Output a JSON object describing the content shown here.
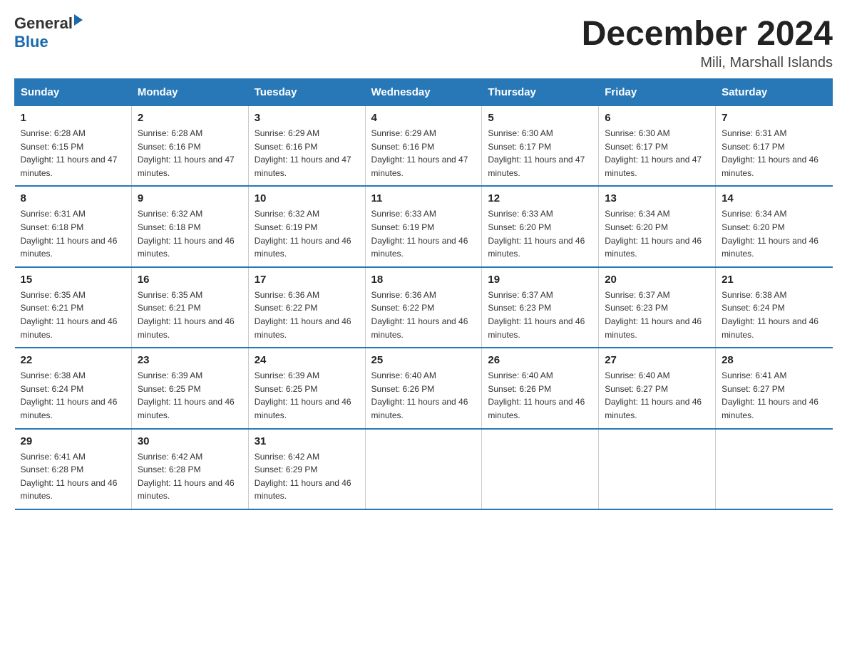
{
  "logo": {
    "general": "General",
    "blue": "Blue"
  },
  "title": "December 2024",
  "location": "Mili, Marshall Islands",
  "days_of_week": [
    "Sunday",
    "Monday",
    "Tuesday",
    "Wednesday",
    "Thursday",
    "Friday",
    "Saturday"
  ],
  "weeks": [
    [
      {
        "day": "1",
        "sunrise": "6:28 AM",
        "sunset": "6:15 PM",
        "daylight": "11 hours and 47 minutes."
      },
      {
        "day": "2",
        "sunrise": "6:28 AM",
        "sunset": "6:16 PM",
        "daylight": "11 hours and 47 minutes."
      },
      {
        "day": "3",
        "sunrise": "6:29 AM",
        "sunset": "6:16 PM",
        "daylight": "11 hours and 47 minutes."
      },
      {
        "day": "4",
        "sunrise": "6:29 AM",
        "sunset": "6:16 PM",
        "daylight": "11 hours and 47 minutes."
      },
      {
        "day": "5",
        "sunrise": "6:30 AM",
        "sunset": "6:17 PM",
        "daylight": "11 hours and 47 minutes."
      },
      {
        "day": "6",
        "sunrise": "6:30 AM",
        "sunset": "6:17 PM",
        "daylight": "11 hours and 47 minutes."
      },
      {
        "day": "7",
        "sunrise": "6:31 AM",
        "sunset": "6:17 PM",
        "daylight": "11 hours and 46 minutes."
      }
    ],
    [
      {
        "day": "8",
        "sunrise": "6:31 AM",
        "sunset": "6:18 PM",
        "daylight": "11 hours and 46 minutes."
      },
      {
        "day": "9",
        "sunrise": "6:32 AM",
        "sunset": "6:18 PM",
        "daylight": "11 hours and 46 minutes."
      },
      {
        "day": "10",
        "sunrise": "6:32 AM",
        "sunset": "6:19 PM",
        "daylight": "11 hours and 46 minutes."
      },
      {
        "day": "11",
        "sunrise": "6:33 AM",
        "sunset": "6:19 PM",
        "daylight": "11 hours and 46 minutes."
      },
      {
        "day": "12",
        "sunrise": "6:33 AM",
        "sunset": "6:20 PM",
        "daylight": "11 hours and 46 minutes."
      },
      {
        "day": "13",
        "sunrise": "6:34 AM",
        "sunset": "6:20 PM",
        "daylight": "11 hours and 46 minutes."
      },
      {
        "day": "14",
        "sunrise": "6:34 AM",
        "sunset": "6:20 PM",
        "daylight": "11 hours and 46 minutes."
      }
    ],
    [
      {
        "day": "15",
        "sunrise": "6:35 AM",
        "sunset": "6:21 PM",
        "daylight": "11 hours and 46 minutes."
      },
      {
        "day": "16",
        "sunrise": "6:35 AM",
        "sunset": "6:21 PM",
        "daylight": "11 hours and 46 minutes."
      },
      {
        "day": "17",
        "sunrise": "6:36 AM",
        "sunset": "6:22 PM",
        "daylight": "11 hours and 46 minutes."
      },
      {
        "day": "18",
        "sunrise": "6:36 AM",
        "sunset": "6:22 PM",
        "daylight": "11 hours and 46 minutes."
      },
      {
        "day": "19",
        "sunrise": "6:37 AM",
        "sunset": "6:23 PM",
        "daylight": "11 hours and 46 minutes."
      },
      {
        "day": "20",
        "sunrise": "6:37 AM",
        "sunset": "6:23 PM",
        "daylight": "11 hours and 46 minutes."
      },
      {
        "day": "21",
        "sunrise": "6:38 AM",
        "sunset": "6:24 PM",
        "daylight": "11 hours and 46 minutes."
      }
    ],
    [
      {
        "day": "22",
        "sunrise": "6:38 AM",
        "sunset": "6:24 PM",
        "daylight": "11 hours and 46 minutes."
      },
      {
        "day": "23",
        "sunrise": "6:39 AM",
        "sunset": "6:25 PM",
        "daylight": "11 hours and 46 minutes."
      },
      {
        "day": "24",
        "sunrise": "6:39 AM",
        "sunset": "6:25 PM",
        "daylight": "11 hours and 46 minutes."
      },
      {
        "day": "25",
        "sunrise": "6:40 AM",
        "sunset": "6:26 PM",
        "daylight": "11 hours and 46 minutes."
      },
      {
        "day": "26",
        "sunrise": "6:40 AM",
        "sunset": "6:26 PM",
        "daylight": "11 hours and 46 minutes."
      },
      {
        "day": "27",
        "sunrise": "6:40 AM",
        "sunset": "6:27 PM",
        "daylight": "11 hours and 46 minutes."
      },
      {
        "day": "28",
        "sunrise": "6:41 AM",
        "sunset": "6:27 PM",
        "daylight": "11 hours and 46 minutes."
      }
    ],
    [
      {
        "day": "29",
        "sunrise": "6:41 AM",
        "sunset": "6:28 PM",
        "daylight": "11 hours and 46 minutes."
      },
      {
        "day": "30",
        "sunrise": "6:42 AM",
        "sunset": "6:28 PM",
        "daylight": "11 hours and 46 minutes."
      },
      {
        "day": "31",
        "sunrise": "6:42 AM",
        "sunset": "6:29 PM",
        "daylight": "11 hours and 46 minutes."
      },
      null,
      null,
      null,
      null
    ]
  ]
}
